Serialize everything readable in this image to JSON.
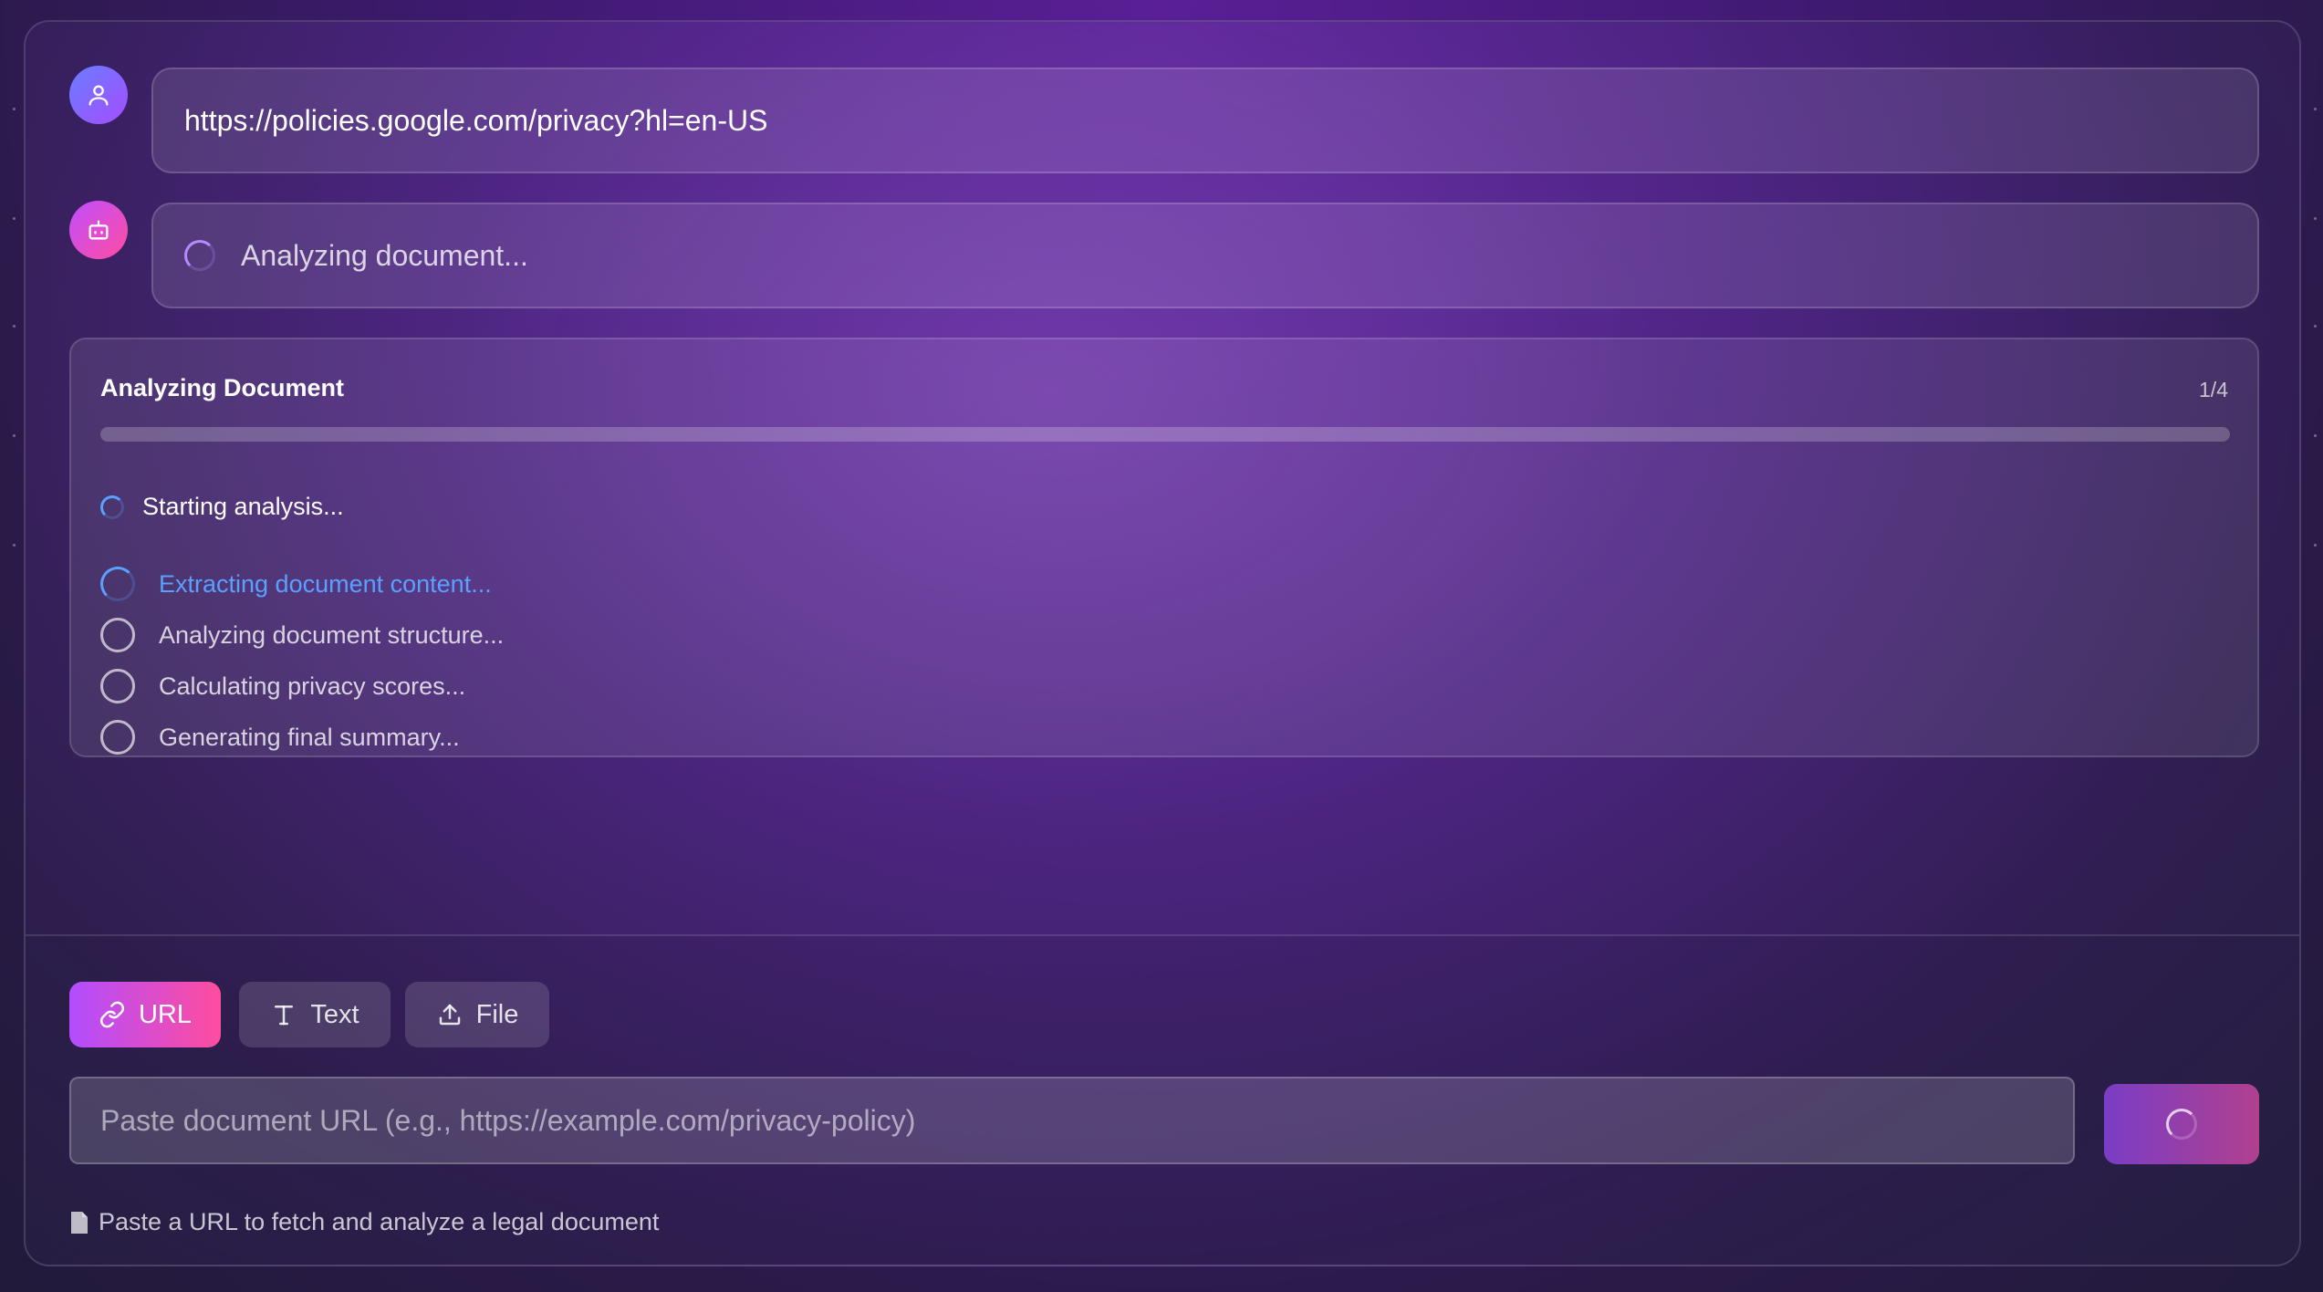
{
  "conversation": {
    "user_message": "https://policies.google.com/privacy?hl=en-US",
    "bot_status": "Analyzing document..."
  },
  "analysis": {
    "title": "Analyzing Document",
    "step_count": "1/4",
    "progress": 0,
    "current_status": "Starting analysis...",
    "steps": [
      {
        "label": "Extracting document content...",
        "state": "active"
      },
      {
        "label": "Analyzing document structure...",
        "state": "pending"
      },
      {
        "label": "Calculating privacy scores...",
        "state": "pending"
      },
      {
        "label": "Generating final summary...",
        "state": "pending"
      }
    ]
  },
  "input_tabs": [
    {
      "label": "URL",
      "icon": "link-icon",
      "active": true
    },
    {
      "label": "Text",
      "icon": "text-icon",
      "active": false
    },
    {
      "label": "File",
      "icon": "upload-icon",
      "active": false
    }
  ],
  "input": {
    "placeholder": "Paste document URL (e.g., https://example.com/privacy-policy)",
    "value": ""
  },
  "hint": {
    "icon": "document-icon",
    "text": "Paste a URL to fetch and analyze a legal document"
  },
  "colors": {
    "accent_gradient_start": "#b14dff",
    "accent_gradient_end": "#ff4d9e",
    "active_step": "#5aa0ff"
  }
}
